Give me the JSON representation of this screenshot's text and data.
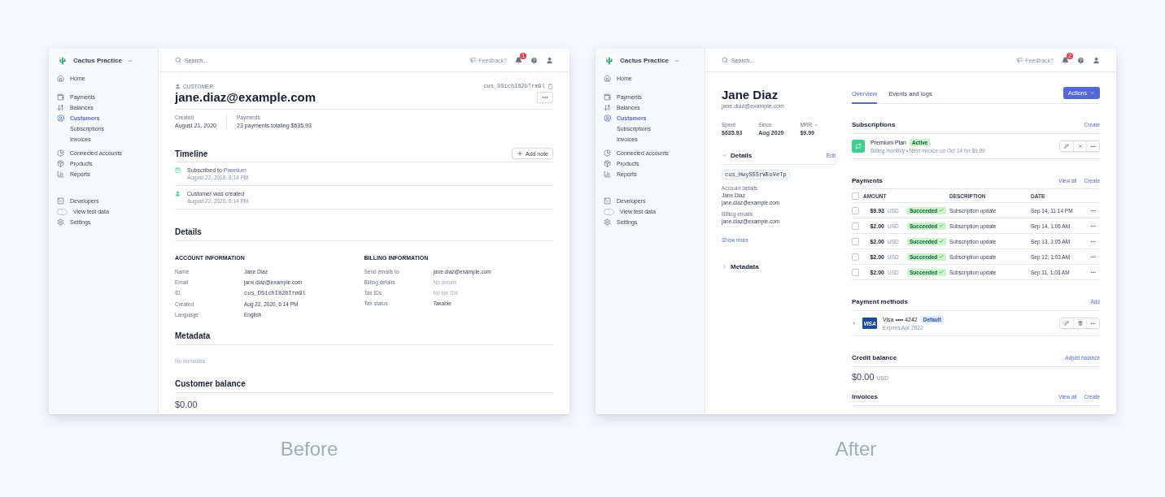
{
  "before": {
    "caption": "Before",
    "sidebar": {
      "account": "Cactus Practice",
      "groups": [
        [
          {
            "label": "Home",
            "kind": "item",
            "selected": false
          }
        ],
        [
          {
            "label": "Payments",
            "kind": "item",
            "selected": false
          },
          {
            "label": "Balances",
            "kind": "item",
            "selected": false
          },
          {
            "label": "Customers",
            "kind": "item",
            "selected": true
          },
          {
            "label": "Subscriptions",
            "kind": "sub",
            "selected": false
          },
          {
            "label": "Invoices",
            "kind": "sub",
            "selected": false
          }
        ],
        [
          {
            "label": "Connected accounts",
            "kind": "item",
            "selected": false
          },
          {
            "label": "Products",
            "kind": "item",
            "selected": false
          },
          {
            "label": "Reports",
            "kind": "item",
            "selected": false
          }
        ],
        [
          {
            "label": "Developers",
            "kind": "item",
            "selected": false
          },
          {
            "label": "View test data",
            "kind": "toggle",
            "selected": false,
            "on": false
          },
          {
            "label": "Settings",
            "kind": "item",
            "selected": false
          }
        ]
      ]
    },
    "topbar": {
      "search_placeholder": "Search...",
      "feedback": "Feedback?",
      "notification_count": "1"
    },
    "customer": {
      "type_label": "CUSTOMER",
      "id": "cus_DSichI82bTrm9l",
      "email": "jane.diaz@example.com",
      "stats": [
        {
          "label": "Created",
          "value": "August 21, 2020"
        },
        {
          "label": "Payments",
          "value": "23 payments totaling $635.93"
        }
      ]
    },
    "timeline": {
      "title": "Timeline",
      "add_button": "Add note",
      "events": [
        {
          "kind": "subscription",
          "text": "Subscribed to",
          "link": "Premium",
          "time": "August 22, 2018, 6:14 PM"
        },
        {
          "kind": "created",
          "text": "Customer was created",
          "time": "August 22, 2020, 6:14 PM"
        }
      ]
    },
    "details": {
      "title": "Details",
      "columns": [
        {
          "heading": "ACCOUNT INFORMATION",
          "rows": [
            {
              "label": "Name",
              "value": "Jane Diaz",
              "kind": "text"
            },
            {
              "label": "Email",
              "value": "jane.diaz@example.com",
              "kind": "text"
            },
            {
              "label": "ID",
              "value": "cus_DSichI82bTrm9l",
              "kind": "code"
            },
            {
              "label": "Created",
              "value": "Aug 22, 2020, 6:14 PM",
              "kind": "text"
            },
            {
              "label": "Language",
              "value": "English",
              "kind": "text"
            }
          ]
        },
        {
          "heading": "BILLING INFORMATION",
          "rows": [
            {
              "label": "Send emails to",
              "value": "jane.diaz@example.com",
              "kind": "text"
            },
            {
              "label": "Billing details",
              "value": "No details",
              "kind": "empty"
            },
            {
              "label": "Tax IDs",
              "value": "No tax IDs",
              "kind": "empty"
            },
            {
              "label": "Tax status",
              "value": "Taxable",
              "kind": "text"
            }
          ]
        }
      ]
    },
    "metadata": {
      "title": "Metadata",
      "empty_text": "No metadata"
    },
    "balance": {
      "title": "Customer balance",
      "amount": "$0.00"
    }
  },
  "after": {
    "caption": "After",
    "sidebar": {
      "account": "Cactus Practice",
      "groups": [
        [
          {
            "label": "Home",
            "kind": "item",
            "selected": false
          }
        ],
        [
          {
            "label": "Payments",
            "kind": "item",
            "selected": false
          },
          {
            "label": "Balances",
            "kind": "item",
            "selected": false
          },
          {
            "label": "Customers",
            "kind": "item",
            "selected": true
          },
          {
            "label": "Subscriptions",
            "kind": "sub",
            "selected": false
          },
          {
            "label": "Invoices",
            "kind": "sub",
            "selected": false
          }
        ],
        [
          {
            "label": "Connected accounts",
            "kind": "item",
            "selected": false
          },
          {
            "label": "Products",
            "kind": "item",
            "selected": false
          },
          {
            "label": "Reports",
            "kind": "item",
            "selected": false
          }
        ],
        [
          {
            "label": "Developers",
            "kind": "item",
            "selected": false
          },
          {
            "label": "View test data",
            "kind": "toggle",
            "selected": false,
            "on": false
          },
          {
            "label": "Settings",
            "kind": "item",
            "selected": false
          }
        ]
      ]
    },
    "topbar": {
      "search_placeholder": "Search...",
      "feedback": "Feedback?",
      "notification_count": "2"
    },
    "profile": {
      "name": "Jane Diaz",
      "email": "jane.diaz@example.com",
      "stats": [
        {
          "label": "Spent",
          "value": "$635.93",
          "kind": "plain"
        },
        {
          "label": "Since",
          "value": "Aug 2020",
          "kind": "plain"
        },
        {
          "label": "MRR",
          "value": "$9.99",
          "kind": "dropdown"
        }
      ]
    },
    "details": {
      "title": "Details",
      "expanded": true,
      "edit": "Edit",
      "id": "cus_HwySSSrWEuVeTp",
      "groups": [
        {
          "label": "Account details",
          "lines": [
            "Jane Diaz",
            "jane.diaz@example.com"
          ]
        },
        {
          "label": "Billing emails",
          "lines": [
            "jane.diaz@example.com"
          ]
        }
      ],
      "more": "Show more"
    },
    "metadata": {
      "title": "Metadata",
      "expanded": false
    },
    "tabs": [
      {
        "label": "Overview",
        "selected": true
      },
      {
        "label": "Events and logs",
        "selected": false
      }
    ],
    "actions": "Actions",
    "subscriptions": {
      "title": "Subscriptions",
      "links": [
        "Create"
      ],
      "items": [
        {
          "name": "Premium Plan",
          "status": "Active",
          "detail": "Billing monthly • Next invoice on Oct 14 for $9.99"
        }
      ]
    },
    "payments": {
      "title": "Payments",
      "links": [
        "View all",
        "Create"
      ],
      "columns": [
        "AMOUNT",
        "DESCRIPTION",
        "DATE"
      ],
      "all_checked": false,
      "rows": [
        {
          "checked": false,
          "amount": "$9.93",
          "currency": "USD",
          "status": "Succeeded",
          "description": "Subscription update",
          "date": "Sep 14, 11:14 PM"
        },
        {
          "checked": false,
          "amount": "$2.00",
          "currency": "USD",
          "status": "Succeeded",
          "description": "Subscription update",
          "date": "Sep 14, 1:06 AM"
        },
        {
          "checked": false,
          "amount": "$2.00",
          "currency": "USD",
          "status": "Succeeded",
          "description": "Subscription update",
          "date": "Sep 13, 1:05 AM"
        },
        {
          "checked": false,
          "amount": "$2.00",
          "currency": "USD",
          "status": "Succeeded",
          "description": "Subscription update",
          "date": "Sep 12, 1:03 AM"
        },
        {
          "checked": false,
          "amount": "$2.00",
          "currency": "USD",
          "status": "Succeeded",
          "description": "Subscription update",
          "date": "Sep 11, 1:03 AM"
        }
      ]
    },
    "payment_methods": {
      "title": "Payment methods",
      "links": [
        "Add"
      ],
      "items": [
        {
          "brand_logo": "VISA",
          "name": "Visa •••• 4242",
          "badge": "Default",
          "expiry": "Expires Apr 2022",
          "expanded": false
        }
      ]
    },
    "credit_balance": {
      "title": "Credit balance",
      "links": [
        "Adjust balance"
      ],
      "amount": "$0.00",
      "currency": "USD"
    },
    "invoices": {
      "title": "Invoices",
      "links": [
        "View all",
        "Create"
      ]
    }
  }
}
